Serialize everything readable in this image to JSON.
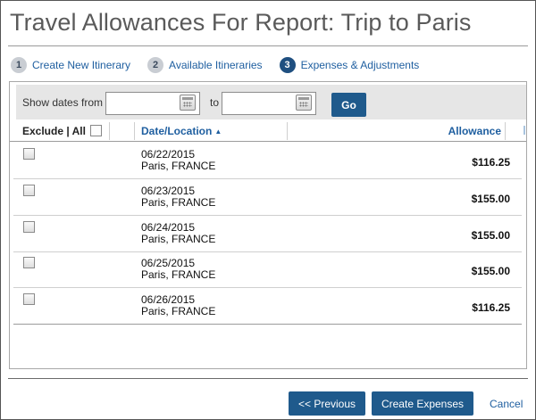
{
  "title": "Travel Allowances For Report: Trip to Paris",
  "steps": [
    {
      "number": "1",
      "label": "Create New Itinerary",
      "active": false
    },
    {
      "number": "2",
      "label": "Available Itineraries",
      "active": false
    },
    {
      "number": "3",
      "label": "Expenses & Adjustments",
      "active": true
    }
  ],
  "filter": {
    "show_dates_label": "Show dates from",
    "to_label": "to",
    "from_value": "",
    "to_value": "",
    "go_label": "Go"
  },
  "table": {
    "columns": {
      "exclude": "Exclude | All",
      "date_location": "Date/Location",
      "allowance": "Allowance"
    },
    "sort_indicator": "▲",
    "rows": [
      {
        "date": "06/22/2015",
        "location": "Paris, FRANCE",
        "allowance": "$116.25",
        "excluded": false
      },
      {
        "date": "06/23/2015",
        "location": "Paris, FRANCE",
        "allowance": "$155.00",
        "excluded": false
      },
      {
        "date": "06/24/2015",
        "location": "Paris, FRANCE",
        "allowance": "$155.00",
        "excluded": false
      },
      {
        "date": "06/25/2015",
        "location": "Paris, FRANCE",
        "allowance": "$155.00",
        "excluded": false
      },
      {
        "date": "06/26/2015",
        "location": "Paris, FRANCE",
        "allowance": "$116.25",
        "excluded": false
      }
    ]
  },
  "footer": {
    "previous_label": "<< Previous",
    "create_label": "Create Expenses",
    "cancel_label": "Cancel"
  },
  "icons": {
    "calendar": "calendar-icon",
    "checkbox": "checkbox-icon"
  },
  "colors": {
    "accent": "#1f5a8c",
    "link": "#1f5fa0",
    "step_active": "#1f4f80",
    "step_inactive": "#c9cdd3"
  }
}
